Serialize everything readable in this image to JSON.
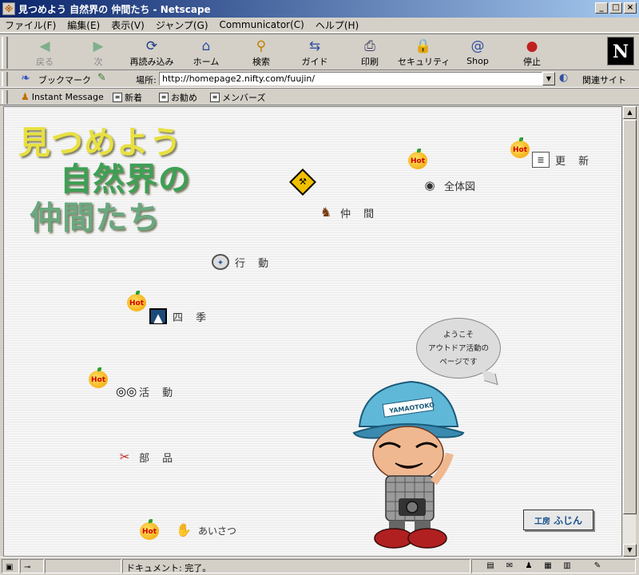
{
  "window": {
    "title": "見つめよう 自然界の 仲間たち - Netscape"
  },
  "menu": [
    "ファイル(F)",
    "編集(E)",
    "表示(V)",
    "ジャンプ(G)",
    "Communicator(C)",
    "ヘルプ(H)"
  ],
  "toolbar": {
    "back": "戻る",
    "forward": "次",
    "reload": "再読み込み",
    "home": "ホーム",
    "search": "検索",
    "guide": "ガイド",
    "print": "印刷",
    "security": "セキュリティ",
    "shop": "Shop",
    "stop": "停止",
    "logo": "N"
  },
  "location": {
    "bookmarks": "ブックマーク",
    "label": "場所:",
    "url": "http://homepage2.nifty.com/fuujin/",
    "related": "関連サイト"
  },
  "personal": [
    "Instant Message",
    "新着",
    "お勧め",
    "メンバーズ"
  ],
  "page": {
    "logo": [
      "見つめよう",
      "自然界の",
      "仲間たち"
    ],
    "hot": "Hot",
    "links": {
      "update": "更 新",
      "overview": "全体図",
      "members": "仲 間",
      "action": "行 動",
      "seasons": "四 季",
      "activities": "活 動",
      "parts": "部 品",
      "greeting": "あいさつ"
    },
    "bubble": [
      "ようこそ",
      "アウトドア活動の",
      "ページです"
    ],
    "cap_text": "YAMAOTOKO",
    "badge": [
      "工房",
      "ふじん"
    ]
  },
  "status": {
    "text": "ドキュメント: 完了。"
  }
}
